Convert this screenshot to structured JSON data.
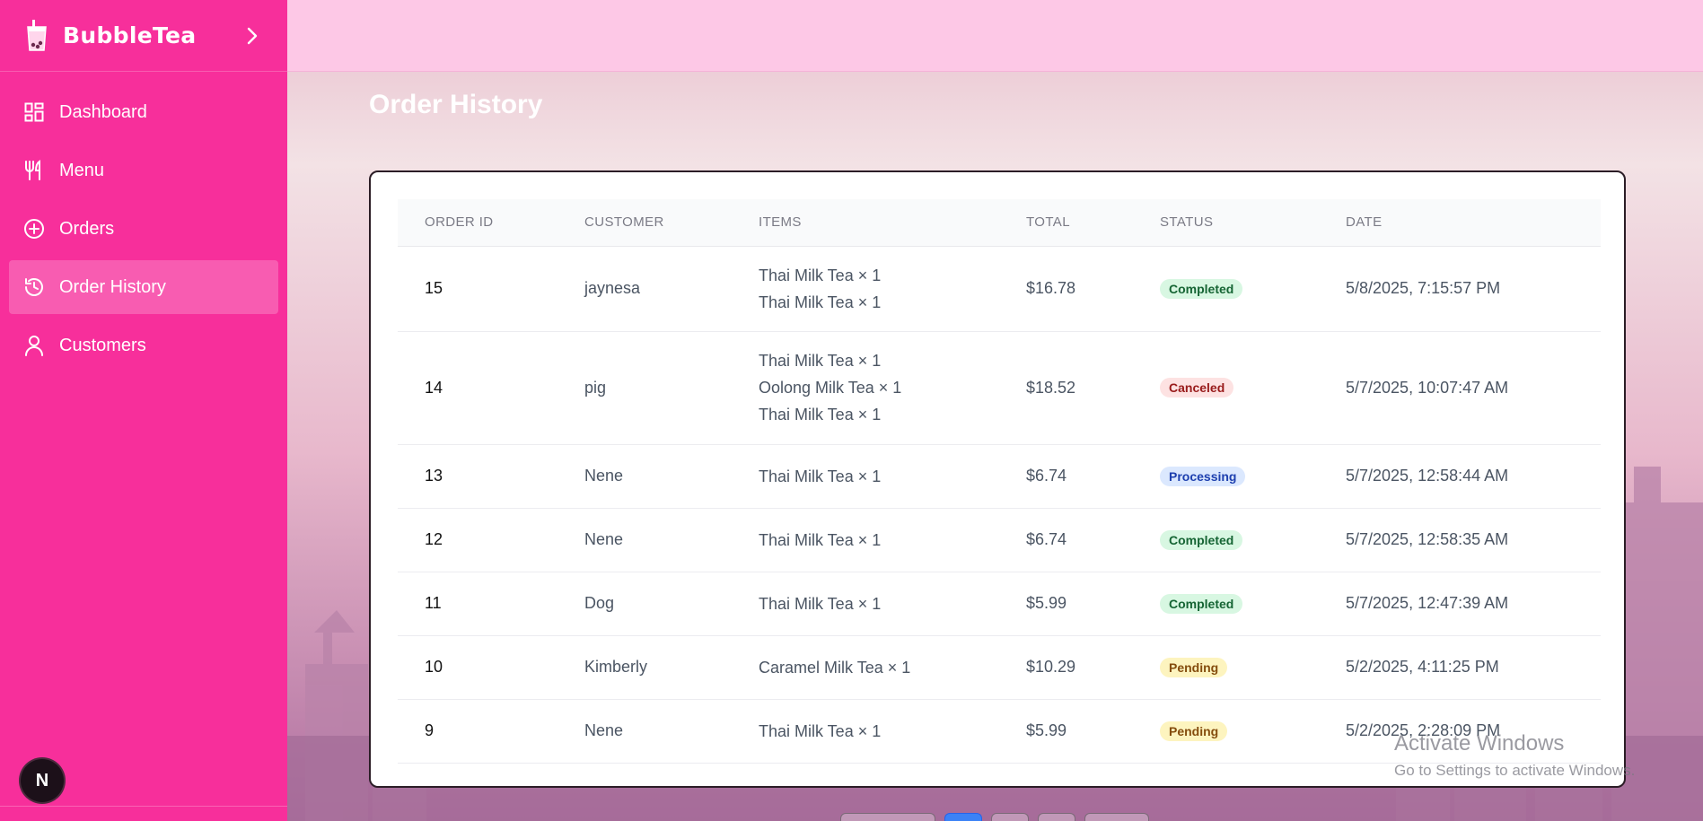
{
  "brand": {
    "name": "BubbleTea",
    "logo_icon": "bubble-tea-cup-icon"
  },
  "sidebar": {
    "items": [
      {
        "label": "Dashboard",
        "icon": "dashboard-grid-icon",
        "active": false
      },
      {
        "label": "Menu",
        "icon": "utensils-icon",
        "active": false
      },
      {
        "label": "Orders",
        "icon": "plus-circle-icon",
        "active": false
      },
      {
        "label": "Order History",
        "icon": "history-icon",
        "active": true
      },
      {
        "label": "Customers",
        "icon": "user-icon",
        "active": false
      }
    ],
    "avatar_letter": "N"
  },
  "main": {
    "title": "Order History",
    "table": {
      "headers": [
        "ORDER ID",
        "CUSTOMER",
        "ITEMS",
        "TOTAL",
        "STATUS",
        "DATE"
      ],
      "rows": [
        {
          "id": "15",
          "customer": "jaynesa",
          "items": [
            "Thai Milk Tea × 1",
            "Thai Milk Tea × 1"
          ],
          "total": "$16.78",
          "status": "Completed",
          "date": "5/8/2025, 7:15:57 PM"
        },
        {
          "id": "14",
          "customer": "pig",
          "items": [
            "Thai Milk Tea × 1",
            "Oolong Milk Tea × 1",
            "Thai Milk Tea × 1"
          ],
          "total": "$18.52",
          "status": "Canceled",
          "date": "5/7/2025, 10:07:47 AM"
        },
        {
          "id": "13",
          "customer": "Nene",
          "items": [
            "Thai Milk Tea × 1"
          ],
          "total": "$6.74",
          "status": "Processing",
          "date": "5/7/2025, 12:58:44 AM"
        },
        {
          "id": "12",
          "customer": "Nene",
          "items": [
            "Thai Milk Tea × 1"
          ],
          "total": "$6.74",
          "status": "Completed",
          "date": "5/7/2025, 12:58:35 AM"
        },
        {
          "id": "11",
          "customer": "Dog",
          "items": [
            "Thai Milk Tea × 1"
          ],
          "total": "$5.99",
          "status": "Completed",
          "date": "5/7/2025, 12:47:39 AM"
        },
        {
          "id": "10",
          "customer": "Kimberly",
          "items": [
            "Caramel Milk Tea × 1"
          ],
          "total": "$10.29",
          "status": "Pending",
          "date": "5/2/2025, 4:11:25 PM"
        },
        {
          "id": "9",
          "customer": "Nene",
          "items": [
            "Thai Milk Tea × 1"
          ],
          "total": "$5.99",
          "status": "Pending",
          "date": "5/2/2025, 2:28:09 PM"
        }
      ]
    }
  },
  "watermark": {
    "line1": "Activate Windows",
    "line2": "Go to Settings to activate Windows."
  },
  "colors": {
    "sidebar": "#f72f9b",
    "topbar": "#fdc8e6",
    "completed": "#166534",
    "canceled": "#991b1b",
    "processing": "#1e40af",
    "pending": "#854d0e"
  }
}
